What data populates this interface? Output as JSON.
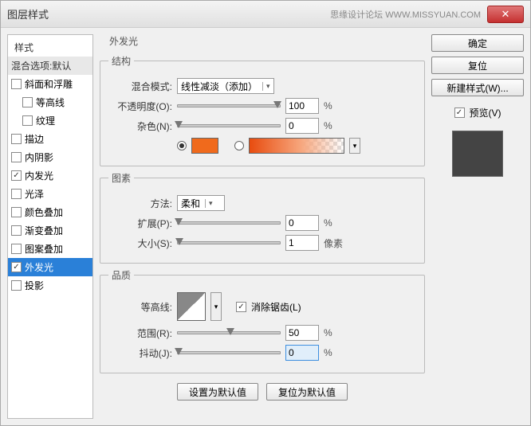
{
  "window": {
    "title": "图层样式",
    "brand": "思缘设计论坛  WWW.MISSYUAN.COM"
  },
  "sidebar": {
    "header": "样式",
    "blend": "混合选项:默认",
    "items": [
      {
        "label": "斜面和浮雕",
        "checked": false
      },
      {
        "label": "等高线",
        "checked": false
      },
      {
        "label": "纹理",
        "checked": false
      },
      {
        "label": "描边",
        "checked": false
      },
      {
        "label": "内阴影",
        "checked": false
      },
      {
        "label": "内发光",
        "checked": true
      },
      {
        "label": "光泽",
        "checked": false
      },
      {
        "label": "颜色叠加",
        "checked": false
      },
      {
        "label": "渐变叠加",
        "checked": false
      },
      {
        "label": "图案叠加",
        "checked": false
      },
      {
        "label": "外发光",
        "checked": true,
        "selected": true
      },
      {
        "label": "投影",
        "checked": false
      }
    ]
  },
  "panel": {
    "title": "外发光",
    "structure": {
      "legend": "结构",
      "blend_label": "混合模式:",
      "blend_value": "线性减淡（添加）",
      "opacity_label": "不透明度(O):",
      "opacity_value": "100",
      "opacity_unit": "%",
      "noise_label": "杂色(N):",
      "noise_value": "0",
      "noise_unit": "%",
      "swatch_color": "#f06a1c"
    },
    "elements": {
      "legend": "图素",
      "technique_label": "方法:",
      "technique_value": "柔和",
      "spread_label": "扩展(P):",
      "spread_value": "0",
      "spread_unit": "%",
      "size_label": "大小(S):",
      "size_value": "1",
      "size_unit": "像素"
    },
    "quality": {
      "legend": "品质",
      "contour_label": "等高线:",
      "antialias_label": "消除锯齿(L)",
      "range_label": "范围(R):",
      "range_value": "50",
      "range_unit": "%",
      "jitter_label": "抖动(J):",
      "jitter_value": "0",
      "jitter_unit": "%"
    },
    "buttons": {
      "default": "设置为默认值",
      "reset": "复位为默认值"
    }
  },
  "right": {
    "ok": "确定",
    "cancel": "复位",
    "newstyle": "新建样式(W)...",
    "preview": "预览(V)"
  }
}
